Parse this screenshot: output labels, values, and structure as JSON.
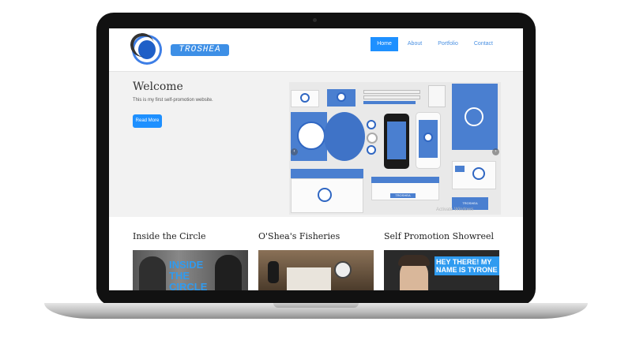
{
  "header": {
    "logo_text": "TROSHEA",
    "nav": [
      {
        "label": "Home",
        "active": true
      },
      {
        "label": "About",
        "active": false
      },
      {
        "label": "Portfolio",
        "active": false
      },
      {
        "label": "Contact",
        "active": false
      }
    ]
  },
  "hero": {
    "title": "Welcome",
    "intro": "This is my first self-promotion website.",
    "button_label": "Read More",
    "carousel": {
      "prev_icon": "chevron-left-icon",
      "next_icon": "chevron-right-icon",
      "usb_label": "TROSHEA",
      "envelope_label": "TROSHEA",
      "watermark": "Activate Windows"
    }
  },
  "portfolio": {
    "items": [
      {
        "title": "Inside the Circle",
        "thumb_text": "INSIDE THE CIRCLE"
      },
      {
        "title": "O'Shea's Fisheries",
        "thumb_text": ""
      },
      {
        "title": "Self Promotion Showreel",
        "thumb_text": "HEY THERE! MY NAME IS TYRONE"
      }
    ]
  },
  "colors": {
    "accent": "#1e90ff",
    "brand_blue": "#4a7fd0"
  }
}
